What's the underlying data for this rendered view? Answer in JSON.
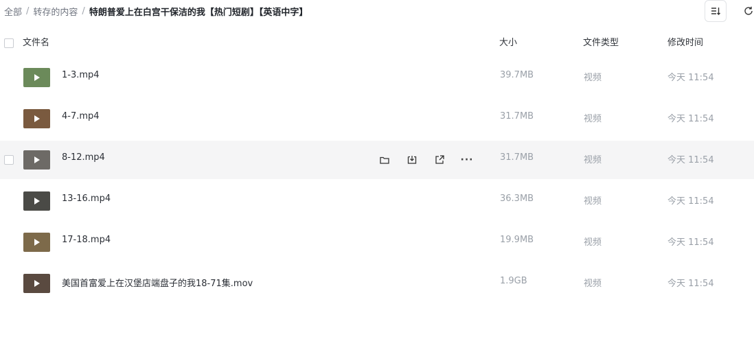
{
  "breadcrumb": {
    "root": "全部",
    "sep": "/",
    "parent": "转存的内容",
    "current": "特朗普爱上在白宫干保洁的我【热门短剧】【英语中字】"
  },
  "toolbar": {
    "sort_icon": "sort-list-icon",
    "refresh_icon": "refresh-icon"
  },
  "table": {
    "headers": {
      "name": "文件名",
      "size": "大小",
      "type": "文件类型",
      "modified": "修改时间"
    },
    "rows": [
      {
        "name": "1-3.mp4",
        "size": "39.7MB",
        "type": "视频",
        "modified": "今天 11:54",
        "thumb_color": "#6b8a5a"
      },
      {
        "name": "4-7.mp4",
        "size": "31.7MB",
        "type": "视频",
        "modified": "今天 11:54",
        "thumb_color": "#7a5a3f"
      },
      {
        "name": "8-12.mp4",
        "size": "31.7MB",
        "type": "视频",
        "modified": "今天 11:54",
        "thumb_color": "#6d6a66"
      },
      {
        "name": "13-16.mp4",
        "size": "36.3MB",
        "type": "视频",
        "modified": "今天 11:54",
        "thumb_color": "#4a4a46"
      },
      {
        "name": "17-18.mp4",
        "size": "19.9MB",
        "type": "视频",
        "modified": "今天 11:54",
        "thumb_color": "#7d6a4a"
      },
      {
        "name": "美国首富爱上在汉堡店端盘子的我18-71集.mov",
        "size": "1.9GB",
        "type": "视频",
        "modified": "今天 11:54",
        "thumb_color": "#5a4a40"
      }
    ],
    "hover_row_index": 2,
    "row_actions": [
      "folder-icon",
      "download-icon",
      "share-icon",
      "more-icon"
    ]
  },
  "colors": {
    "hover_bg": "#f5f5f6",
    "muted_text": "#9aa0a8"
  }
}
